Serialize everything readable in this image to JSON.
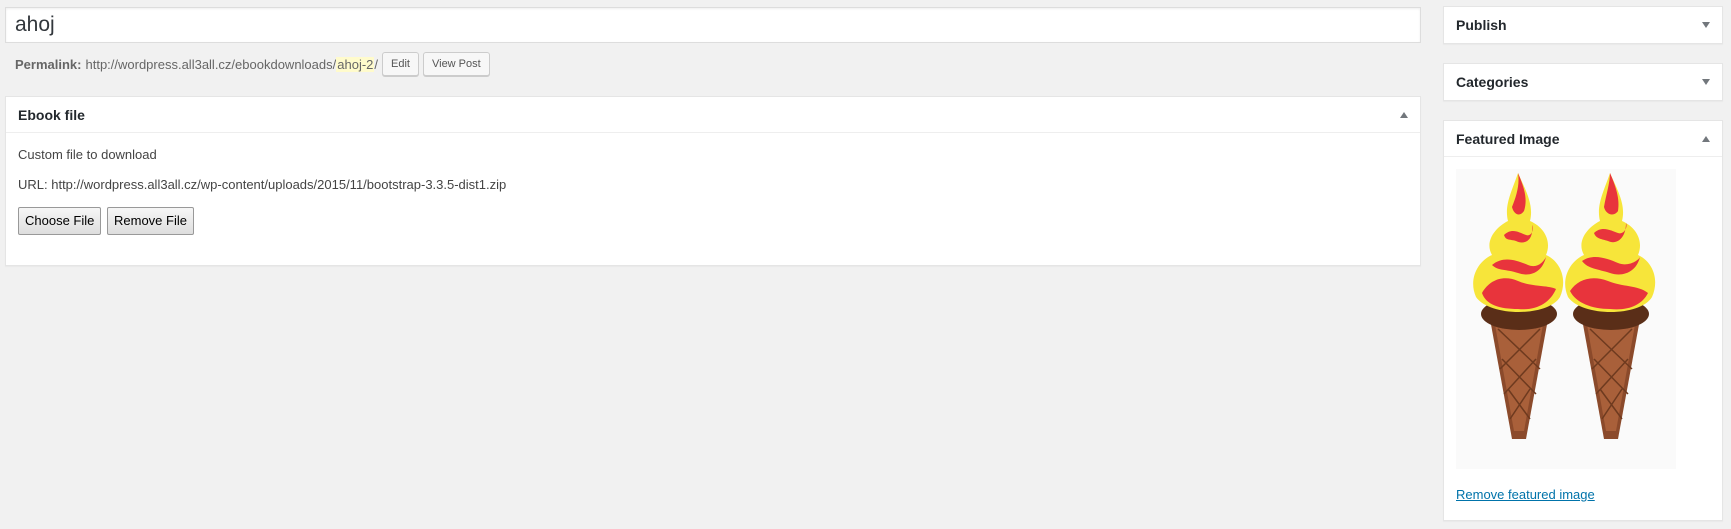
{
  "post": {
    "title": "ahoj",
    "permalink_label": "Permalink:",
    "permalink_base": "http://wordpress.all3all.cz/ebookdownloads/",
    "permalink_slug": "ahoj-2",
    "permalink_trail": "/",
    "edit_label": "Edit",
    "view_label": "View Post"
  },
  "ebook": {
    "title": "Ebook file",
    "description": "Custom file to download",
    "url_text": "URL: http://wordpress.all3all.cz/wp-content/uploads/2015/11/bootstrap-3.3.5-dist1.zip",
    "choose_label": "Choose File",
    "remove_label": "Remove File"
  },
  "sidebar": {
    "publish_title": "Publish",
    "categories_title": "Categories",
    "featured_title": "Featured Image",
    "remove_featured_label": "Remove featured image"
  },
  "colors": {
    "background": "#f1f1f1",
    "link": "#0073aa",
    "slug_highlight": "#fffbcc",
    "icecream_red": "#e8343c",
    "icecream_yellow": "#f7e53a",
    "cone": "#a0522d"
  },
  "icons": {
    "toggle_collapsed": "triangle-down-icon",
    "toggle_expanded": "triangle-up-icon"
  }
}
